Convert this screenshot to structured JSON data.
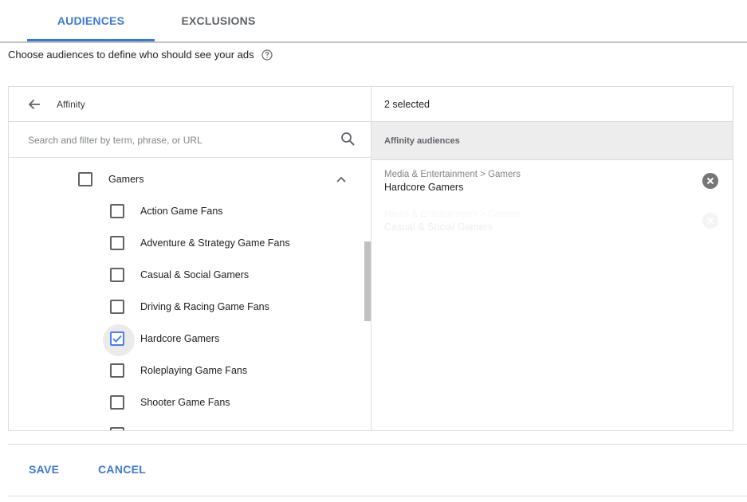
{
  "tabs": [
    {
      "label": "AUDIENCES",
      "active": true
    },
    {
      "label": "EXCLUSIONS",
      "active": false
    }
  ],
  "intro": {
    "text": "Choose audiences to define who should see your ads",
    "icon": "help-circle-icon"
  },
  "browse": {
    "title": "Affinity",
    "back_icon": "arrow-left-icon",
    "search": {
      "placeholder": "Search and filter by term, phrase, or URL",
      "value": "",
      "icon": "search-icon"
    },
    "category": {
      "label": "Gamers",
      "checked": false,
      "expanded": true
    },
    "items": [
      {
        "label": "Action Game Fans",
        "checked": false
      },
      {
        "label": "Adventure & Strategy Game Fans",
        "checked": false
      },
      {
        "label": "Casual & Social Gamers",
        "checked": false
      },
      {
        "label": "Driving & Racing Game Fans",
        "checked": false
      },
      {
        "label": "Hardcore Gamers",
        "checked": true
      },
      {
        "label": "Roleplaying Game Fans",
        "checked": false
      },
      {
        "label": "Shooter Game Fans",
        "checked": false
      }
    ]
  },
  "selected": {
    "count_label": "2 selected",
    "group_title": "Affinity audiences",
    "items": [
      {
        "path": "Media & Entertainment > Gamers",
        "name": "Hardcore Gamers"
      },
      {
        "path": "Media & Entertainment > Gamers",
        "name": "Casual & Social Gamers"
      }
    ]
  },
  "footer": {
    "save_label": "SAVE",
    "cancel_label": "CANCEL"
  },
  "colors": {
    "accent": "#3c78d8",
    "checkbox_checked": "#4a80e8",
    "border": "#dadce0",
    "group_bg": "#ededed"
  }
}
